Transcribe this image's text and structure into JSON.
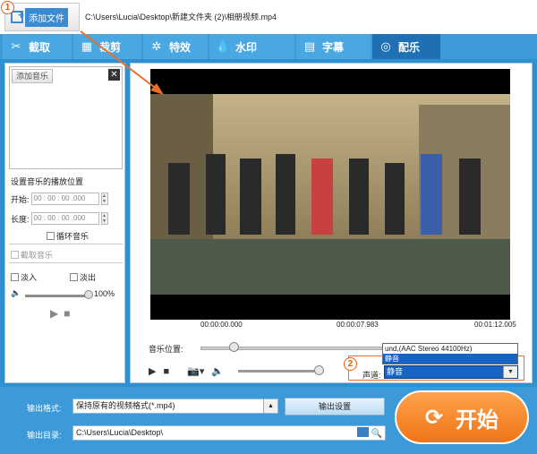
{
  "topbar": {
    "add_file_label": "添加文件",
    "file_path": "C:\\Users\\Lucia\\Desktop\\新建文件夹 (2)\\相册视频.mp4",
    "callout_1": "1"
  },
  "tabs": [
    {
      "label": "截取",
      "icon": "scissors-icon"
    },
    {
      "label": "裁剪",
      "icon": "crop-icon"
    },
    {
      "label": "特效",
      "icon": "effects-icon"
    },
    {
      "label": "水印",
      "icon": "watermark-icon"
    },
    {
      "label": "字幕",
      "icon": "subtitle-icon"
    },
    {
      "label": "配乐",
      "icon": "music-icon",
      "active": true
    }
  ],
  "music_panel": {
    "add_music_label": "添加音乐",
    "close_label": "✕",
    "position_title": "设置音乐的播放位置",
    "start_label": "开始:",
    "start_value": "00 : 00 : 00 .000",
    "length_label": "长度:",
    "length_value": "00 : 00 : 00 .000",
    "loop_label": "循环音乐",
    "cut_label": "截取音乐",
    "fade_in_label": "淡入",
    "fade_out_label": "淡出",
    "volume_value": "100%"
  },
  "player": {
    "time_start": "00:00:00.000",
    "time_current": "00:00:07.983",
    "time_end": "00:01:12.005",
    "music_position_label": "音乐位置:",
    "audio_track_label": "声道:",
    "audio_track_selected": "静音",
    "audio_track_options": [
      "und,(AAC Stereo 44100Hz)",
      "静音"
    ],
    "callout_2": "2"
  },
  "output": {
    "format_label": "输出格式:",
    "format_value": "保持原有的视频格式(*.mp4)",
    "settings_label": "输出设置",
    "dir_label": "输出目录:",
    "dir_value": "C:\\Users\\Lucia\\Desktop\\",
    "start_label": "开始"
  },
  "colors": {
    "accent": "#3c9ad8",
    "start": "#f07418",
    "callout": "#e25b0e"
  }
}
